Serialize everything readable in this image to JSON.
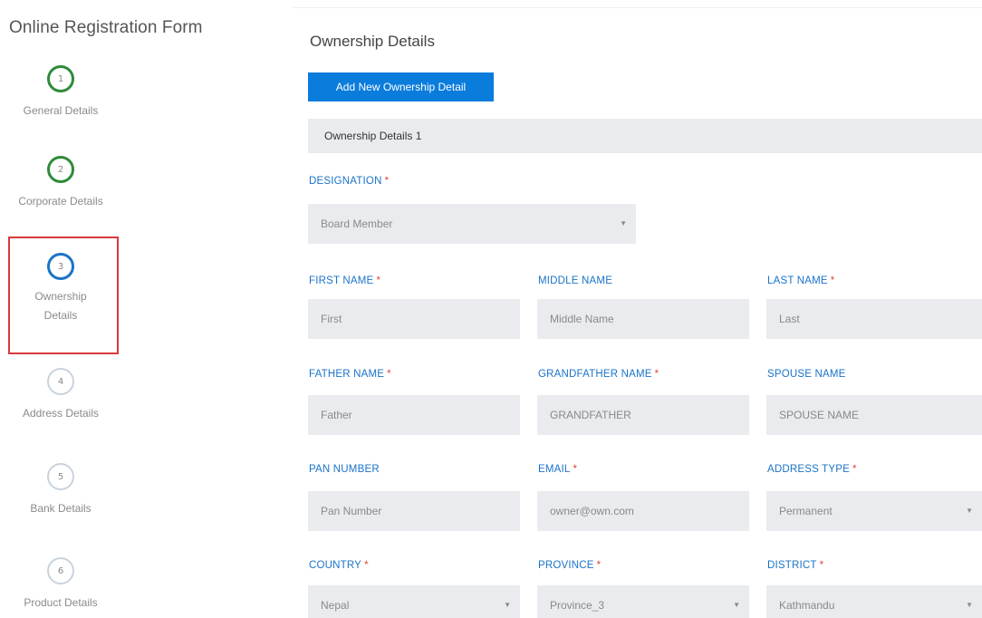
{
  "sidebar": {
    "title": "Online Registration Form",
    "steps": [
      {
        "number": "1",
        "label": "General Details",
        "state": "done"
      },
      {
        "number": "2",
        "label": "Corporate Details",
        "state": "done"
      },
      {
        "number": "3",
        "label_line1": "Ownership",
        "label_line2": "Details",
        "state": "active"
      },
      {
        "number": "4",
        "label": "Address Details",
        "state": "todo"
      },
      {
        "number": "5",
        "label": "Bank Details",
        "state": "todo"
      },
      {
        "number": "6",
        "label": "Product Details",
        "state": "todo"
      }
    ]
  },
  "main": {
    "title": "Ownership Details",
    "add_button": "Add New Ownership Detail",
    "group_title": "Ownership Details 1",
    "fields": {
      "designation": {
        "label": "DESIGNATION",
        "required": "*",
        "value": "Board Member"
      },
      "first_name": {
        "label": "FIRST NAME",
        "required": "*",
        "placeholder": "First"
      },
      "middle_name": {
        "label": "MIDDLE NAME",
        "placeholder": "Middle Name"
      },
      "last_name": {
        "label": "LAST NAME",
        "required": "*",
        "placeholder": "Last"
      },
      "father_name": {
        "label": "FATHER NAME",
        "required": "*",
        "placeholder": "Father"
      },
      "grandfather_name": {
        "label": "GRANDFATHER NAME",
        "required": "*",
        "placeholder": "GRANDFATHER"
      },
      "spouse_name": {
        "label": "SPOUSE NAME",
        "placeholder": "SPOUSE NAME"
      },
      "pan_number": {
        "label": "PAN NUMBER",
        "placeholder": "Pan Number"
      },
      "email": {
        "label": "EMAIL",
        "required": "*",
        "placeholder": "owner@own.com"
      },
      "address_type": {
        "label": "ADDRESS TYPE",
        "required": "*",
        "value": "Permanent"
      },
      "country": {
        "label": "COUNTRY",
        "required": "*",
        "value": "Nepal"
      },
      "province": {
        "label": "PROVINCE",
        "required": "*",
        "value": "Province_3"
      },
      "district": {
        "label": "DISTRICT",
        "required": "*",
        "value": "Kathmandu"
      }
    },
    "dropdown_caret": "▼"
  },
  "colors": {
    "accent": "#0a7cdc",
    "step_done": "#2e8b3a",
    "step_active": "#1a73c9",
    "highlight": "#d8393d",
    "required": "#e0433f"
  }
}
